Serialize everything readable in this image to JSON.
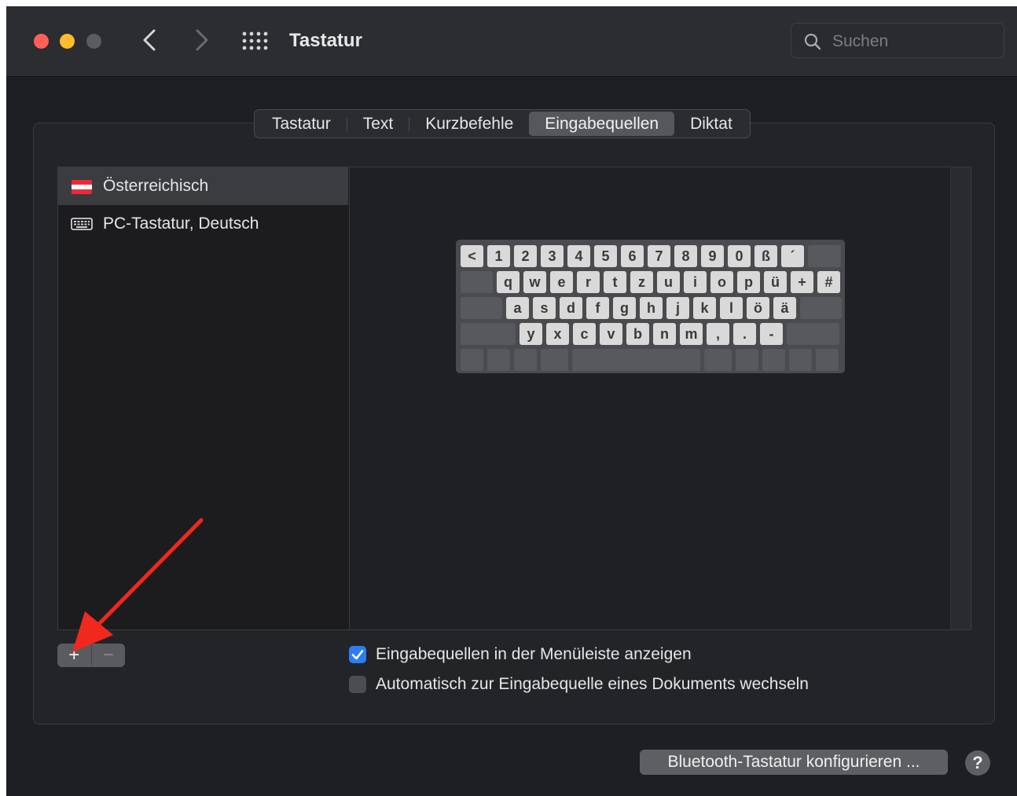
{
  "window": {
    "title": "Tastatur"
  },
  "search": {
    "placeholder": "Suchen"
  },
  "tabs": [
    {
      "label": "Tastatur",
      "selected": false
    },
    {
      "label": "Text",
      "selected": false
    },
    {
      "label": "Kurzbefehle",
      "selected": false
    },
    {
      "label": "Eingabequellen",
      "selected": true
    },
    {
      "label": "Diktat",
      "selected": false
    }
  ],
  "input_sources": [
    {
      "label": "Österreichisch",
      "icon": "austria-flag-icon",
      "selected": true
    },
    {
      "label": "PC-Tastatur, Deutsch",
      "icon": "keyboard-icon",
      "selected": false
    }
  ],
  "keyboard_rows": [
    [
      "<",
      "1",
      "2",
      "3",
      "4",
      "5",
      "6",
      "7",
      "8",
      "9",
      "0",
      "ß",
      "´"
    ],
    [
      "q",
      "w",
      "e",
      "r",
      "t",
      "z",
      "u",
      "i",
      "o",
      "p",
      "ü",
      "+",
      "#"
    ],
    [
      "a",
      "s",
      "d",
      "f",
      "g",
      "h",
      "j",
      "k",
      "l",
      "ö",
      "ä"
    ],
    [
      "y",
      "x",
      "c",
      "v",
      "b",
      "n",
      "m",
      ",",
      ".",
      "-"
    ]
  ],
  "list_buttons": {
    "add": "+",
    "remove": "−"
  },
  "options": {
    "show_in_menu_bar": {
      "label": "Eingabequellen in der Menüleiste anzeigen",
      "checked": true
    },
    "auto_switch": {
      "label": "Automatisch zur Eingabequelle eines Dokuments wechseln",
      "checked": false
    }
  },
  "footer": {
    "bluetooth_button": "Bluetooth-Tastatur konfigurieren ...",
    "help": "?"
  },
  "colors": {
    "accent": "#2d7df6",
    "annotation_arrow": "#f0281e"
  }
}
